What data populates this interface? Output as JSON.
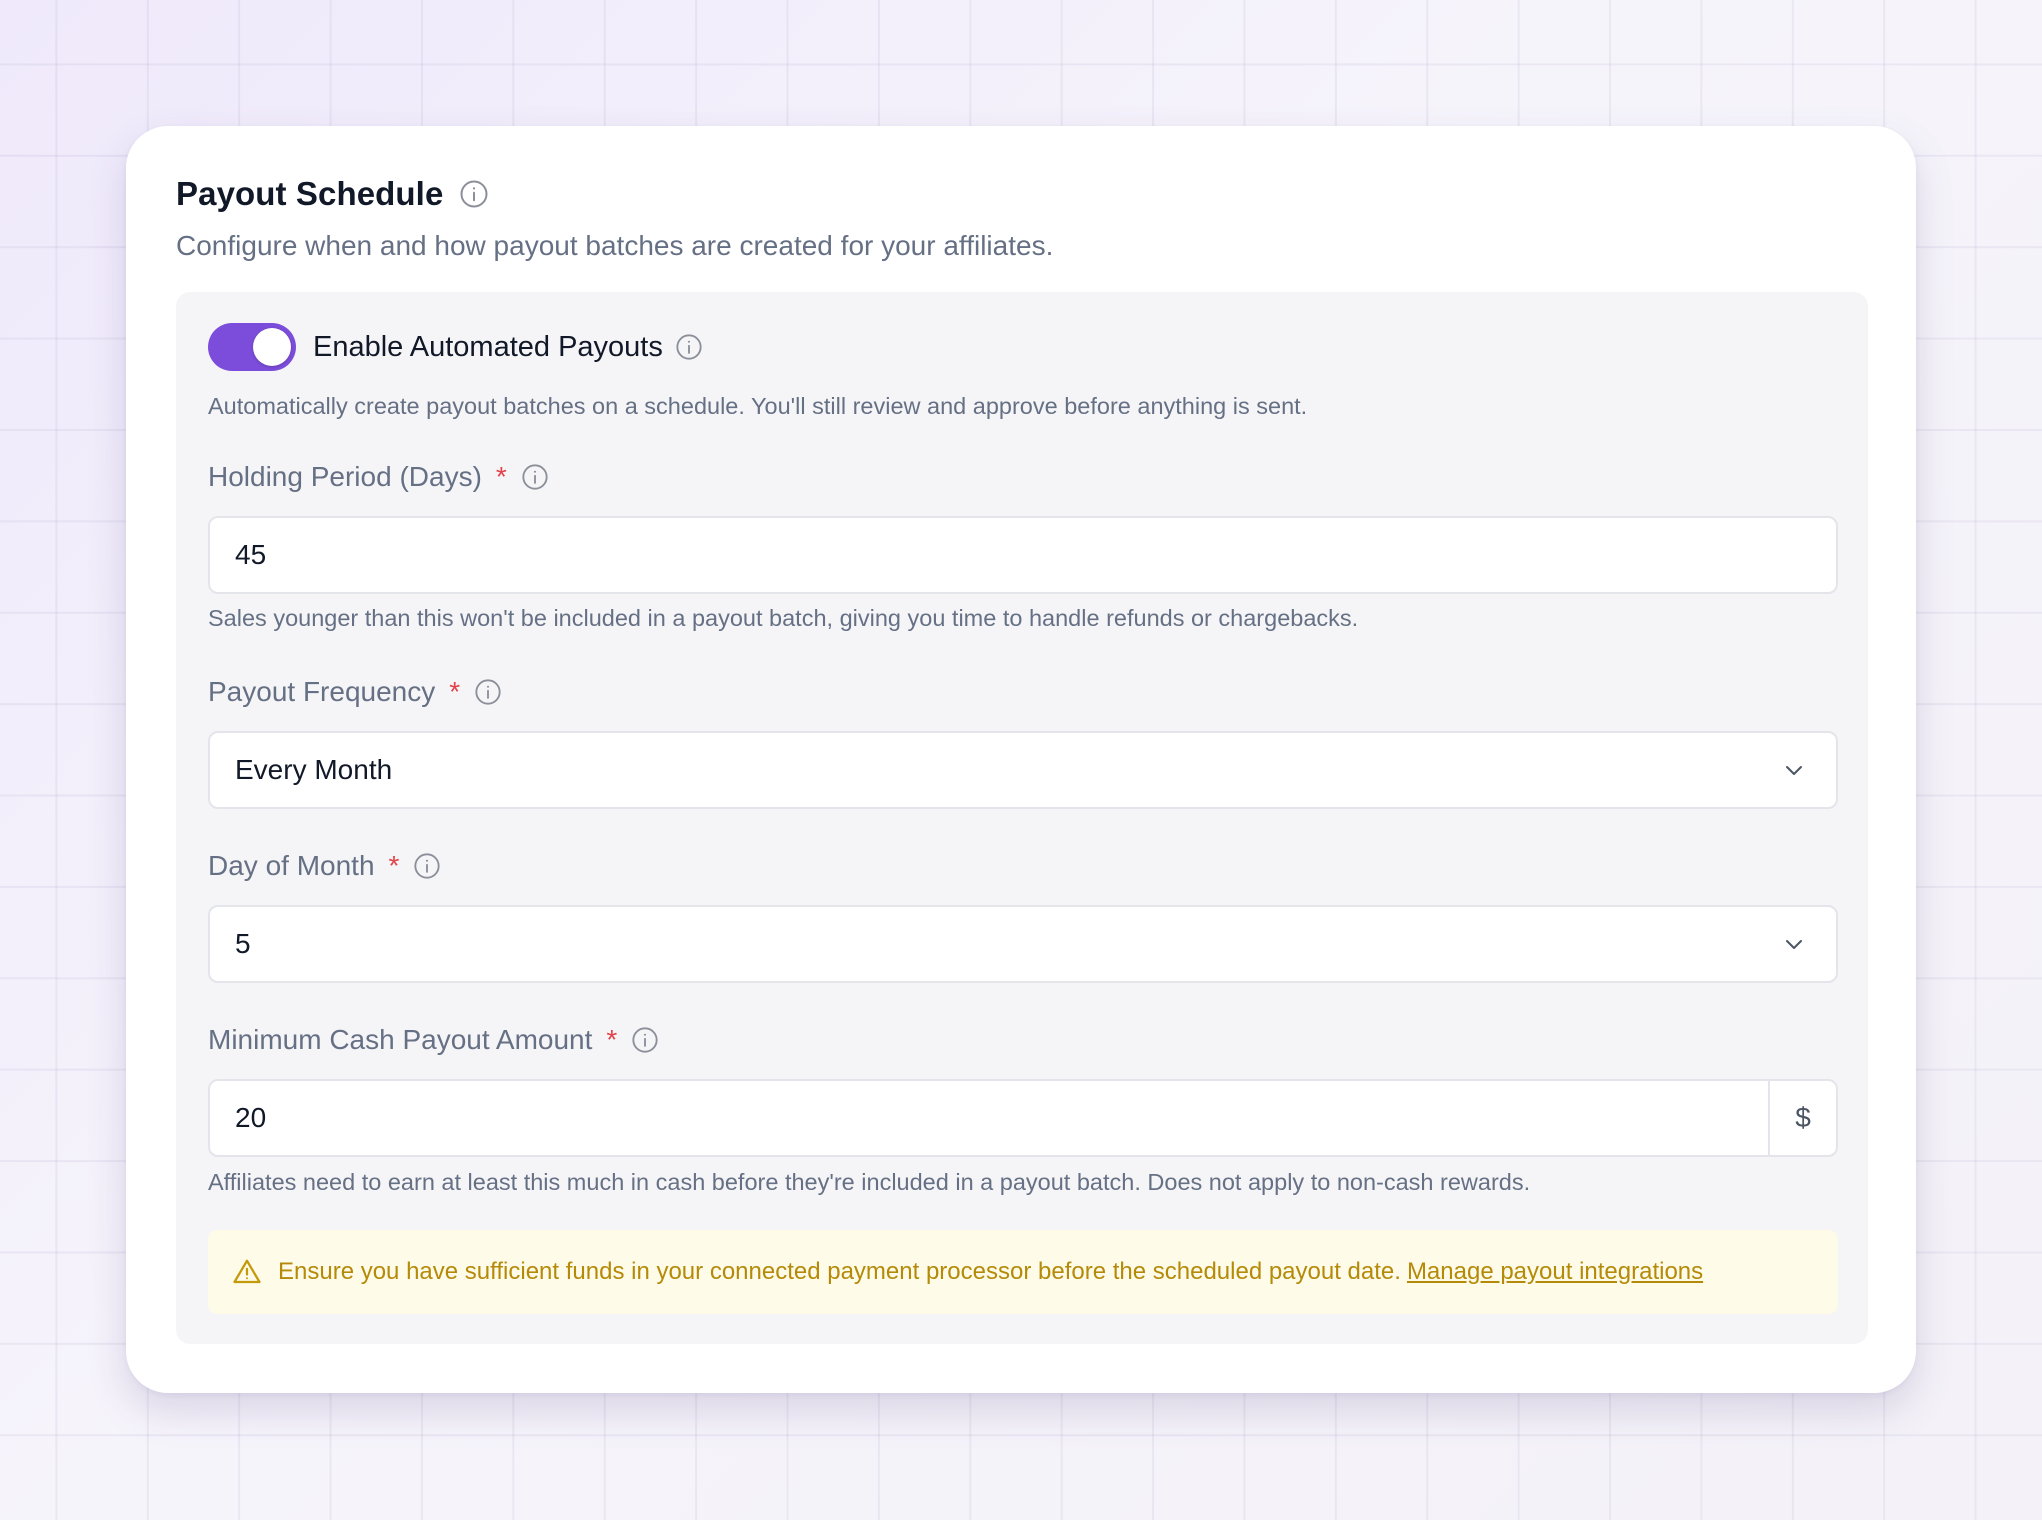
{
  "header": {
    "title": "Payout Schedule",
    "subtitle": "Configure when and how payout batches are created for your affiliates."
  },
  "automation": {
    "toggle_label": "Enable Automated Payouts",
    "enabled": true,
    "description": "Automatically create payout batches on a schedule. You'll still review and approve before anything is sent."
  },
  "holding_period": {
    "label": "Holding Period (Days)",
    "required_mark": "*",
    "value": "45",
    "help": "Sales younger than this won't be included in a payout batch, giving you time to handle refunds or chargebacks."
  },
  "payout_frequency": {
    "label": "Payout Frequency",
    "required_mark": "*",
    "selected": "Every Month"
  },
  "day_of_month": {
    "label": "Day of Month",
    "required_mark": "*",
    "selected": "5"
  },
  "minimum_payout": {
    "label": "Minimum Cash Payout Amount",
    "required_mark": "*",
    "value": "20",
    "currency_suffix": "$",
    "help": "Affiliates need to earn at least this much in cash before they're included in a payout batch. Does not apply to non-cash rewards."
  },
  "alert": {
    "icon": "warning-triangle-icon",
    "text": "Ensure you have sufficient funds in your connected payment processor before the scheduled payout date.",
    "link_text": "Manage payout integrations"
  },
  "colors": {
    "accent": "#7c4ddb",
    "required": "#e0444a",
    "warning_text": "#b58a08",
    "warning_bg": "#fefbe8"
  }
}
